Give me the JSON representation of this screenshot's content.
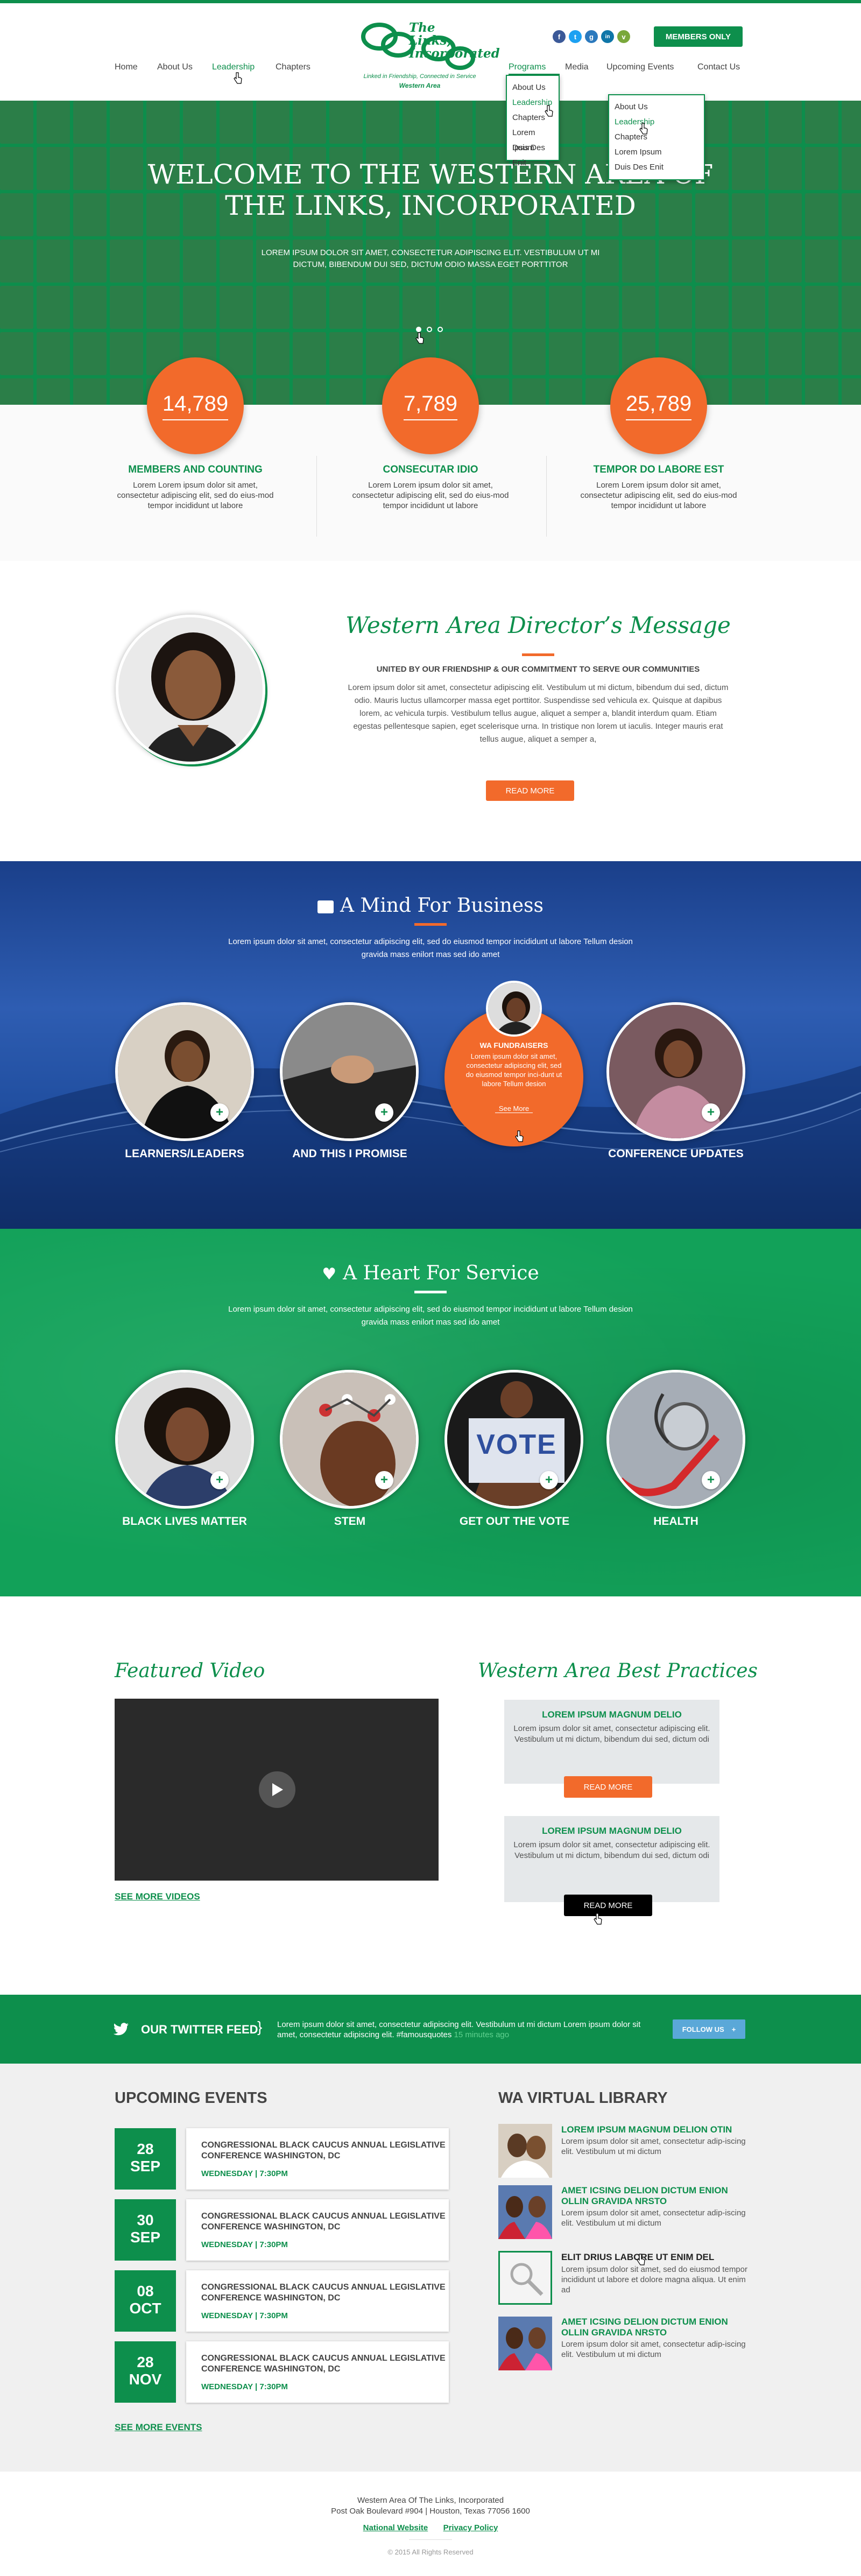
{
  "header": {
    "logo_title": "The Links, Incorporated",
    "logo_tagline": "Linked in Friendship, Connected in Service",
    "logo_sub": "Western Area",
    "nav_left": [
      "Home",
      "About Us",
      "Leadership",
      "Chapters"
    ],
    "nav_right": [
      "Programs",
      "Media",
      "Upcoming Events",
      "Contact Us"
    ],
    "members_label": "MEMBERS ONLY",
    "social": [
      "f",
      "t",
      "g",
      "in",
      "v"
    ]
  },
  "dropdown1": [
    "About Us",
    "Leadership",
    "Chapters",
    "Lorem Ipsum",
    "Duis Des Enit"
  ],
  "dropdown2": [
    "About Us",
    "Leadership",
    "Chapters",
    "Lorem Ipsum",
    "Duis Des Enit"
  ],
  "hero": {
    "title_line1": "WELCOME TO THE WESTERN AREA OF",
    "title_line2": "THE LINKS, INCORPORATED",
    "text": "LOREM IPSUM DOLOR SIT AMET, CONSECTETUR ADIPISCING ELIT. VESTIBULUM UT MI DICTUM, BIBENDUM DUI SED, DICTUM ODIO MASSA EGET PORTTITOR"
  },
  "stats": [
    {
      "value": "14,789",
      "title": "MEMBERS AND COUNTING",
      "text": "Lorem Lorem ipsum dolor sit amet, consectetur adipiscing elit, sed do eius-mod tempor incididunt ut labore"
    },
    {
      "value": "7,789",
      "title": "CONSECUTAR IDIO",
      "text": "Lorem Lorem ipsum dolor sit amet, consectetur adipiscing elit, sed do eius-mod tempor incididunt ut labore"
    },
    {
      "value": "25,789",
      "title": "TEMPOR DO LABORE EST",
      "text": "Lorem Lorem ipsum dolor sit amet, consectetur adipiscing elit, sed do eius-mod tempor incididunt ut labore"
    }
  ],
  "director": {
    "title": "Western Area Director’s Message",
    "subtitle": "UNITED BY OUR FRIENDSHIP & OUR COMMITMENT TO SERVE OUR COMMUNITIES",
    "body": "Lorem ipsum dolor sit amet, consectetur adipiscing elit. Vestibulum ut mi dictum, bibendum dui sed, dictum odio. Mauris luctus ullamcorper massa eget porttitor. Suspendisse sed vehicula ex. Quisque at dapibus lorem, ac vehicula turpis. Vestibulum tellus augue, aliquet a semper a, blandit interdum quam. Etiam egestas pellentesque sapien, eget scelerisque urna. In tristique non lorem ut iaculis. Integer mauris erat tellus augue, aliquet a semper a,",
    "button": "READ MORE"
  },
  "business": {
    "title": "A Mind For Business",
    "text": "Lorem ipsum dolor sit amet, consectetur adipiscing elit, sed do eiusmod tempor incididunt ut labore Tellum desion gravida mass enilort mas sed ido amet",
    "items": [
      {
        "label": "LEARNERS/LEADERS"
      },
      {
        "label": "AND THIS I PROMISE"
      },
      {
        "label": ""
      },
      {
        "label": "CONFERENCE UPDATES"
      }
    ],
    "feature": {
      "title": "WA FUNDRAISERS",
      "text": "Lorem ipsum dolor sit amet, consectetur adipiscing elit, sed do eiusmod tempor inci-dunt ut labore Tellum desion",
      "link": "See More"
    }
  },
  "service": {
    "title": "A Heart For Service",
    "text": "Lorem ipsum dolor sit amet, consectetur adipiscing elit, sed do eiusmod tempor incididunt ut labore Tellum desion gravida mass enilort mas sed ido amet",
    "items": [
      {
        "label": "BLACK LIVES MATTER"
      },
      {
        "label": "STEM"
      },
      {
        "label": "GET OUT THE VOTE"
      },
      {
        "label": "HEALTH"
      }
    ],
    "vote": "VOTE"
  },
  "featured": {
    "video_title": "Featured Video",
    "see_more_videos": "SEE MORE VIDEOS",
    "bp_title": "Western Area Best Practices",
    "cards": [
      {
        "title": "LOREM IPSUM MAGNUM DELIO",
        "text": "Lorem ipsum dolor sit amet, consectetur adipiscing elit. Vestibulum ut mi dictum, bibendum dui sed, dictum odi",
        "button": "READ MORE"
      },
      {
        "title": "LOREM IPSUM MAGNUM DELIO",
        "text": "Lorem ipsum dolor sit amet, consectetur adipiscing elit. Vestibulum ut mi dictum, bibendum dui sed, dictum odi",
        "button": "READ MORE"
      }
    ]
  },
  "twitter": {
    "label": "OUR TWITTER FEED",
    "text": "Lorem ipsum dolor sit amet, consectetur adipiscing elit. Vestibulum ut mi dictum Lorem ipsum dolor sit amet, consectetur adipiscing elit. #famousquotes",
    "time": "15 minutes ago",
    "follow": "FOLLOW US"
  },
  "events": {
    "heading": "UPCOMING EVENTS",
    "see_more": "SEE MORE EVENTS",
    "items": [
      {
        "day": "28",
        "month": "SEP",
        "title": "CONGRESSIONAL BLACK CAUCUS ANNUAL LEGISLATIVE CONFERENCE WASHINGTON, DC",
        "when": "WEDNESDAY | 7:30PM"
      },
      {
        "day": "30",
        "month": "SEP",
        "title": "CONGRESSIONAL BLACK CAUCUS ANNUAL LEGISLATIVE CONFERENCE WASHINGTON, DC",
        "when": "WEDNESDAY | 7:30PM"
      },
      {
        "day": "08",
        "month": "OCT",
        "title": "CONGRESSIONAL BLACK CAUCUS ANNUAL LEGISLATIVE CONFERENCE WASHINGTON, DC",
        "when": "WEDNESDAY | 7:30PM"
      },
      {
        "day": "28",
        "month": "NOV",
        "title": "CONGRESSIONAL BLACK CAUCUS ANNUAL LEGISLATIVE CONFERENCE WASHINGTON, DC",
        "when": "WEDNESDAY | 7:30PM"
      }
    ]
  },
  "library": {
    "heading": "WA VIRTUAL LIBRARY",
    "items": [
      {
        "title": "LOREM IPSUM MAGNUM DELION OTIN",
        "text": "Lorem ipsum dolor sit amet, consectetur adip-iscing elit. Vestibulum ut mi dictum"
      },
      {
        "title": "AMET ICSING DELION DICTUM ENION OLLIN GRAVIDA NRSTO",
        "text": "Lorem ipsum dolor sit amet, consectetur adip-iscing elit. Vestibulum ut mi dictum"
      },
      {
        "title": "ELIT DRIUS LABORE UT ENIM DEL",
        "text": "Lorem ipsum dolor sit amet, sed do eiusmod tempor incididunt ut labore et dolore magna aliqua. Ut enim ad"
      },
      {
        "title": "AMET ICSING DELION DICTUM ENION OLLIN GRAVIDA NRSTO",
        "text": "Lorem ipsum dolor sit amet, consectetur adip-iscing elit. Vestibulum ut mi dictum"
      }
    ]
  },
  "footer": {
    "line1": "Western Area Of The Links, Incorporated",
    "line2": "Post Oak Boulevard #904 | Houston, Texas 77056 1600",
    "link1": "National Website",
    "link2": "Privacy Policy",
    "copyright": "© 2015 All Rights Reserved"
  },
  "colors": {
    "brand_green": "#0d8f4c",
    "accent_orange": "#f26a2b",
    "twitter_blue": "#5aa8d8"
  }
}
